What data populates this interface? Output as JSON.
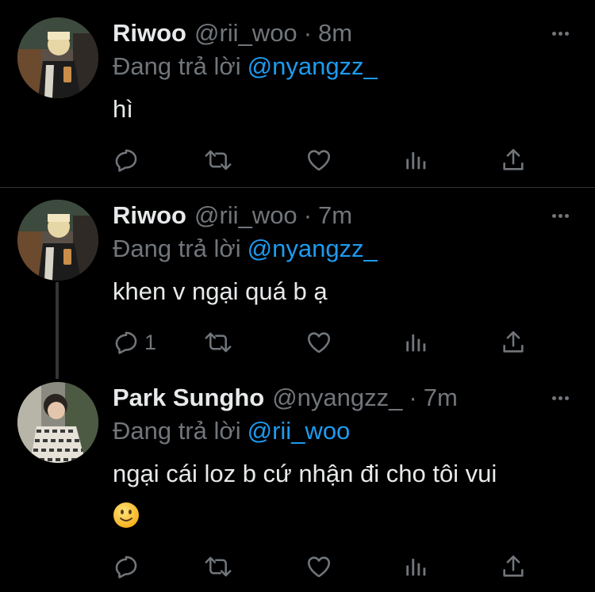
{
  "tweets": [
    {
      "name": "Riwoo",
      "handle": "@rii_woo",
      "dot": "·",
      "time": "8m",
      "reply_prefix": "Đang trả lời",
      "reply_to": "@nyangzz_",
      "text_line1": "hì",
      "reply_count": ""
    },
    {
      "name": "Riwoo",
      "handle": "@rii_woo",
      "dot": "·",
      "time": "7m",
      "reply_prefix": "Đang trả lời",
      "reply_to": "@nyangzz_",
      "text_line1": "khen v ngại quá b ạ",
      "reply_count": "1"
    },
    {
      "name": "Park Sungho",
      "handle": "@nyangzz_",
      "dot": "·",
      "time": "7m",
      "reply_prefix": "Đang trả lời",
      "reply_to": "@rii_woo",
      "text_line1": "ngại cái loz b cứ nhận đi cho tôi vui",
      "emoji": "slightly-smiling-face"
    }
  ],
  "icons": {
    "reply": "reply-icon",
    "retweet": "retweet-icon",
    "like": "like-icon",
    "views": "views-icon",
    "share": "share-icon",
    "more": "more-icon"
  },
  "colors": {
    "background": "#000000",
    "text": "#e7e9ea",
    "secondary": "#71767b",
    "accent": "#1d9bf0",
    "divider": "#2f3336"
  }
}
